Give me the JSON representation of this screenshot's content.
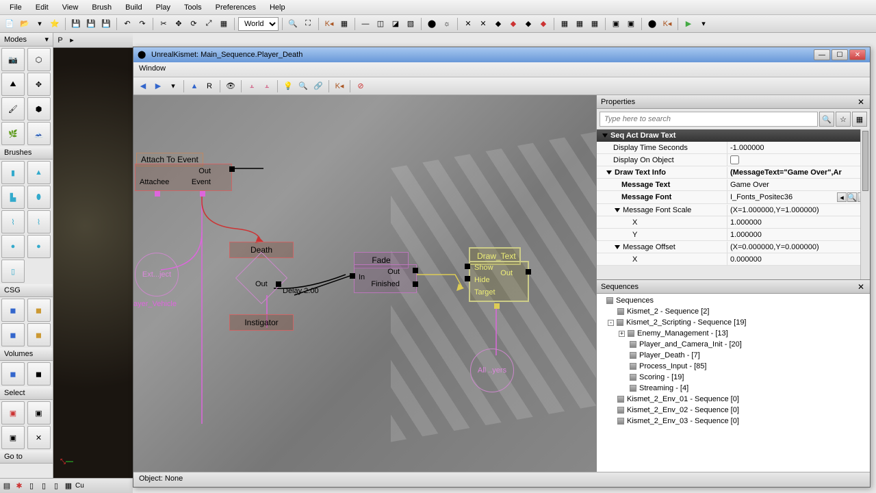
{
  "menu": {
    "items": [
      "File",
      "Edit",
      "View",
      "Brush",
      "Build",
      "Play",
      "Tools",
      "Preferences",
      "Help"
    ]
  },
  "world_select": "World",
  "sidebar": {
    "modes": "Modes",
    "brushes": "Brushes",
    "csg": "CSG",
    "volumes": "Volumes",
    "select": "Select",
    "goto": "Go to"
  },
  "kismet": {
    "title": "UnrealKismet: Main_Sequence.Player_Death",
    "menu_window": "Window",
    "status": "Object: None",
    "nodes": {
      "attach_title": "Attach To Event",
      "attachee": "Attachee",
      "event": "Event",
      "out": "Out",
      "death": "Death",
      "instigator": "Instigator",
      "fade": "Fade",
      "in": "In",
      "finished": "Finished",
      "draw_text": "Draw_Text",
      "show": "Show",
      "hide": "Hide",
      "target": "Target",
      "delay": "Delay 2.00",
      "ext": "Ext...ject",
      "vehicle": "ayer_Vehicle",
      "allplayers": "All ..yers"
    }
  },
  "props": {
    "title": "Properties",
    "search_placeholder": "Type here to search",
    "cat": "Seq Act Draw Text",
    "rows": {
      "display_time": "Display Time Seconds",
      "display_time_v": "-1.000000",
      "display_obj": "Display On Object",
      "draw_info": "Draw Text Info",
      "draw_info_v": "(MessageText=\"Game Over\",Ar",
      "msg_text": "Message Text",
      "msg_text_v": "Game Over",
      "msg_font": "Message Font",
      "msg_font_v": "I_Fonts_Positec36",
      "msg_scale": "Message Font Scale",
      "msg_scale_v": "(X=1.000000,Y=1.000000)",
      "x": "X",
      "x_v": "1.000000",
      "y": "Y",
      "y_v": "1.000000",
      "msg_offset": "Message Offset",
      "msg_offset_v": "(X=0.000000,Y=0.000000)",
      "x2_v": "0.000000"
    }
  },
  "seq": {
    "title": "Sequences",
    "root": "Sequences",
    "items": [
      "Kismet_2 - Sequence [2]",
      "Kismet_2_Scripting - Sequence [19]",
      "Enemy_Management - [13]",
      "Player_and_Camera_Init - [20]",
      "Player_Death - [7]",
      "Process_Input - [85]",
      "Scoring - [19]",
      "Streaming - [4]",
      "Kismet_2_Env_01 - Sequence [0]",
      "Kismet_2_Env_02 - Sequence [0]",
      "Kismet_2_Env_03 - Sequence [0]"
    ]
  }
}
